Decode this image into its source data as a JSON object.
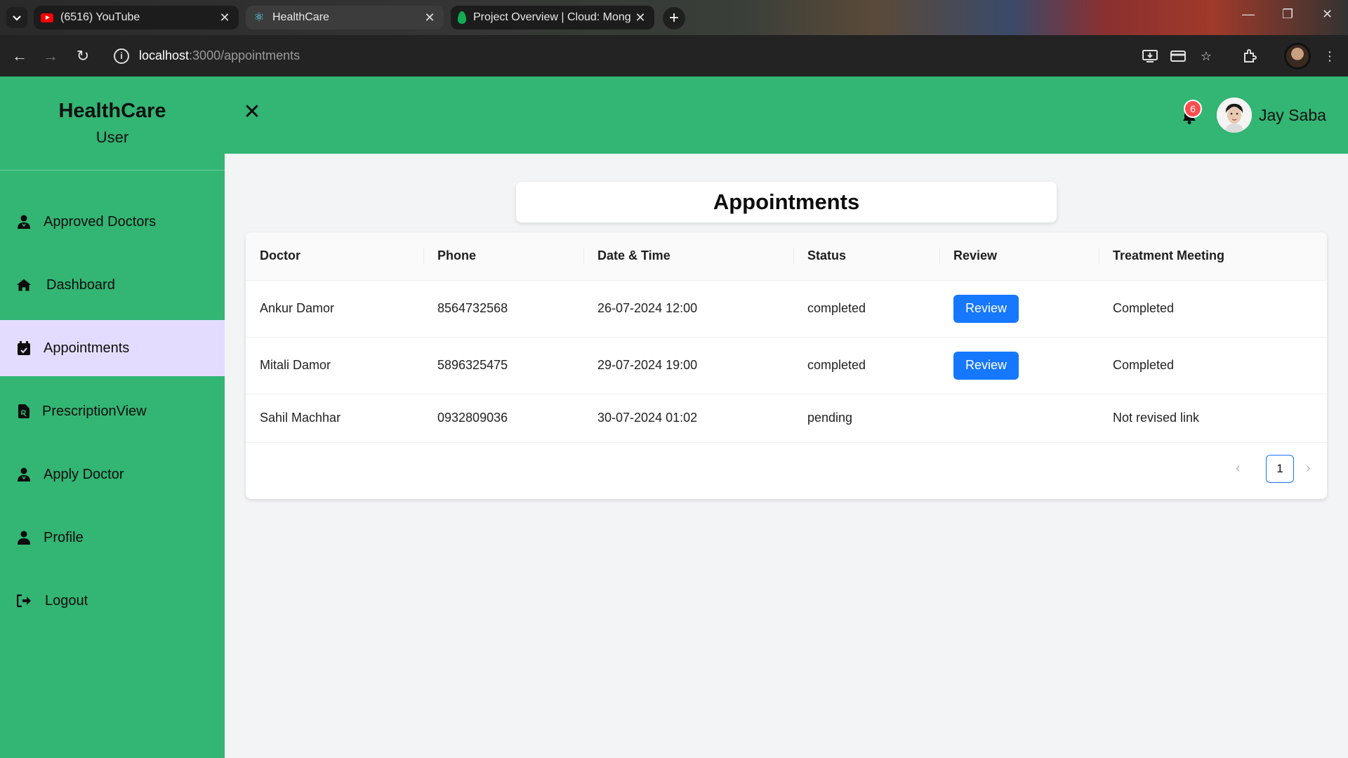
{
  "browser": {
    "tabs": [
      {
        "title": "(6516) YouTube",
        "favicon": "youtube-icon"
      },
      {
        "title": "HealthCare",
        "favicon": "react-icon"
      },
      {
        "title": "Project Overview | Cloud: Mong",
        "favicon": "mongodb-icon"
      }
    ],
    "url_host": "localhost",
    "url_path": ":3000/appointments"
  },
  "app": {
    "brand_title": "HealthCare",
    "brand_subtitle": "User",
    "menu": [
      {
        "label": "Approved Doctors",
        "icon": "user-doctor-icon"
      },
      {
        "label": "Dashboard",
        "icon": "home-icon"
      },
      {
        "label": "Appointments",
        "icon": "calendar-check-icon"
      },
      {
        "label": "PrescriptionView",
        "icon": "file-prescription-icon"
      },
      {
        "label": "Apply Doctor",
        "icon": "user-doctor-icon"
      },
      {
        "label": "Profile",
        "icon": "user-icon"
      },
      {
        "label": "Logout",
        "icon": "logout-icon"
      }
    ],
    "active_menu": "Appointments",
    "notification_count": "6",
    "user_name": "Jay Saba",
    "accent_color": "#33b574",
    "active_menu_color": "#e4dcfe",
    "button_color": "#1677ff"
  },
  "page": {
    "title": "Appointments",
    "columns": [
      "Doctor",
      "Phone",
      "Date & Time",
      "Status",
      "Review",
      "Treatment Meeting"
    ],
    "rows": [
      {
        "doctor": "Ankur Damor",
        "phone": "8564732568",
        "datetime": "26-07-2024 12:00",
        "status": "completed",
        "review": "Review",
        "meeting": "Completed"
      },
      {
        "doctor": "Mitali Damor",
        "phone": "5896325475",
        "datetime": "29-07-2024 19:00",
        "status": "completed",
        "review": "Review",
        "meeting": "Completed"
      },
      {
        "doctor": "Sahil Machhar",
        "phone": "0932809036",
        "datetime": "30-07-2024 01:02",
        "status": "pending",
        "review": "",
        "meeting": "Not revised link"
      }
    ],
    "pagination": {
      "current": "1"
    }
  }
}
